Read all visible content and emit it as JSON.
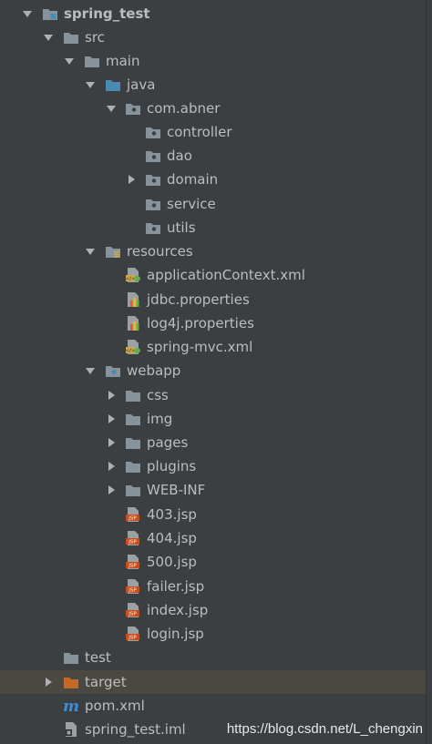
{
  "tree": [
    {
      "label": "spring_test",
      "icon": "module-folder-icon",
      "arrow": "down",
      "bold": true
    },
    {
      "label": "src",
      "icon": "folder-icon",
      "arrow": "down"
    },
    {
      "label": "main",
      "icon": "folder-icon",
      "arrow": "down"
    },
    {
      "label": "java",
      "icon": "source-folder-icon",
      "arrow": "down"
    },
    {
      "label": "com.abner",
      "icon": "package-icon",
      "arrow": "down"
    },
    {
      "label": "controller",
      "icon": "package-icon",
      "arrow": "none"
    },
    {
      "label": "dao",
      "icon": "package-icon",
      "arrow": "none"
    },
    {
      "label": "domain",
      "icon": "package-icon",
      "arrow": "right"
    },
    {
      "label": "service",
      "icon": "package-icon",
      "arrow": "none"
    },
    {
      "label": "utils",
      "icon": "package-icon",
      "arrow": "none"
    },
    {
      "label": "resources",
      "icon": "resources-folder-icon",
      "arrow": "down"
    },
    {
      "label": "applicationContext.xml",
      "icon": "spring-xml-file-icon",
      "arrow": "none"
    },
    {
      "label": "jdbc.properties",
      "icon": "properties-file-icon",
      "arrow": "none"
    },
    {
      "label": "log4j.properties",
      "icon": "properties-file-icon",
      "arrow": "none"
    },
    {
      "label": "spring-mvc.xml",
      "icon": "spring-xml-file-icon",
      "arrow": "none"
    },
    {
      "label": "webapp",
      "icon": "web-folder-icon",
      "arrow": "down"
    },
    {
      "label": "css",
      "icon": "folder-icon",
      "arrow": "right"
    },
    {
      "label": "img",
      "icon": "folder-icon",
      "arrow": "right"
    },
    {
      "label": "pages",
      "icon": "folder-icon",
      "arrow": "right"
    },
    {
      "label": "plugins",
      "icon": "folder-icon",
      "arrow": "right"
    },
    {
      "label": "WEB-INF",
      "icon": "folder-icon",
      "arrow": "right"
    },
    {
      "label": "403.jsp",
      "icon": "jsp-file-icon",
      "arrow": "none"
    },
    {
      "label": "404.jsp",
      "icon": "jsp-file-icon",
      "arrow": "none"
    },
    {
      "label": "500.jsp",
      "icon": "jsp-file-icon",
      "arrow": "none"
    },
    {
      "label": "failer.jsp",
      "icon": "jsp-file-icon",
      "arrow": "none"
    },
    {
      "label": "index.jsp",
      "icon": "jsp-file-icon",
      "arrow": "none"
    },
    {
      "label": "login.jsp",
      "icon": "jsp-file-icon",
      "arrow": "none"
    },
    {
      "label": "test",
      "icon": "folder-icon",
      "arrow": "right"
    },
    {
      "label": "target",
      "icon": "excluded-folder-icon",
      "arrow": "right",
      "highlight": true
    },
    {
      "label": "pom.xml",
      "icon": "maven-pom-icon",
      "arrow": "none"
    },
    {
      "label": "spring_test.iml",
      "icon": "iml-file-icon",
      "arrow": "none"
    }
  ],
  "watermark": "https://blog.csdn.net/L_chengxin",
  "colors": {
    "background": "#3c3f41",
    "text": "#bbbdbe",
    "folder": "#87939a",
    "source_folder": "#4a8bb5",
    "excluded_folder": "#c36a2a",
    "highlight_row": "#4b4741",
    "jsp": "#c35020",
    "spring_leaf": "#6aab4c",
    "maven": "#3c8fd5"
  }
}
